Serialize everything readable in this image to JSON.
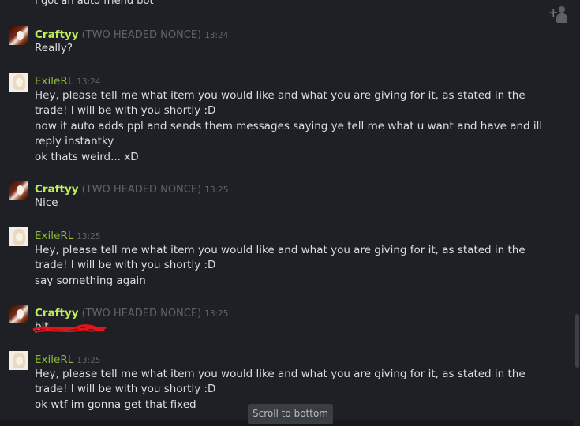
{
  "partial_top_message": "I got an auto friend bot",
  "messages": [
    {
      "sender": "Craftyy",
      "nickname": "(TWO HEADED NONCE)",
      "time": "13:24",
      "lines": [
        "Really?"
      ]
    },
    {
      "sender": "ExileRL",
      "time": "13:24",
      "lines": [
        "Hey, please tell me what item you would like and what you are giving for it, as stated in the trade! I will be with you shortly :D",
        "now it auto adds ppl and sends them messages saying ye tell me what u want and have and ill reply instantky",
        "ok thats weird... xD"
      ]
    },
    {
      "sender": "Craftyy",
      "nickname": "(TWO HEADED NONCE)",
      "time": "13:25",
      "lines": [
        "Nice"
      ]
    },
    {
      "sender": "ExileRL",
      "time": "13:25",
      "lines": [
        "Hey, please tell me what item you would like and what you are giving for it, as stated in the trade! I will be with you shortly :D",
        "say something again"
      ]
    },
    {
      "sender": "Craftyy",
      "nickname": "(TWO HEADED NONCE)",
      "time": "13:25",
      "lines": [
        "bit"
      ]
    },
    {
      "sender": "ExileRL",
      "time": "13:25",
      "lines": [
        "Hey, please tell me what item you would like and what you are giving for it, as stated in the trade! I will be with you shortly :D",
        "ok wtf im gonna get that fixed"
      ]
    }
  ],
  "scroll_to_bottom_label": "Scroll to bottom",
  "icons": {
    "add_friend": "add-friend-icon"
  },
  "colors": {
    "background": "#1e2025",
    "friend_ingame": "#bdee5c",
    "friend_online": "#8fb93b",
    "muted": "#626366",
    "text": "#dcdedf",
    "scribble": "#e0161c"
  }
}
